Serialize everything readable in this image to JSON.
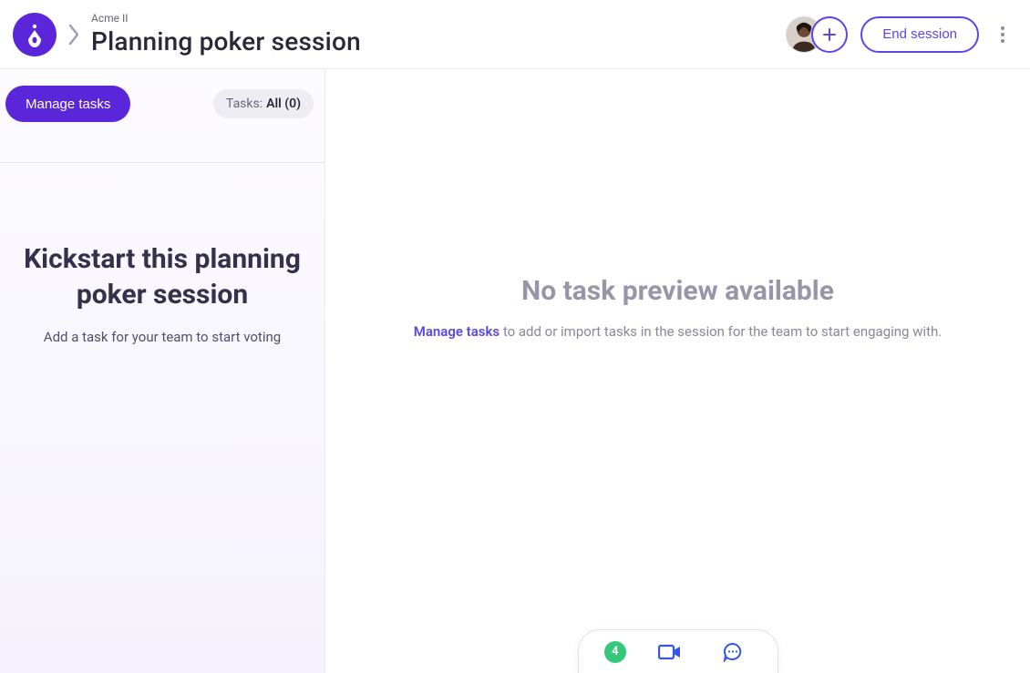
{
  "header": {
    "org": "Acme II",
    "title": "Planning poker session",
    "end_session_label": "End session"
  },
  "sidebar": {
    "manage_label": "Manage tasks",
    "tasks_filter_prefix": "Tasks:",
    "tasks_filter_value": "All (0)",
    "empty_heading": "Kickstart this planning poker session",
    "empty_sub": "Add a task for your team to start voting"
  },
  "main": {
    "empty_heading": "No task preview available",
    "empty_link": "Manage tasks",
    "empty_rest": " to add or import tasks in the session for the team to start engaging with."
  },
  "dock": {
    "count": "4"
  }
}
